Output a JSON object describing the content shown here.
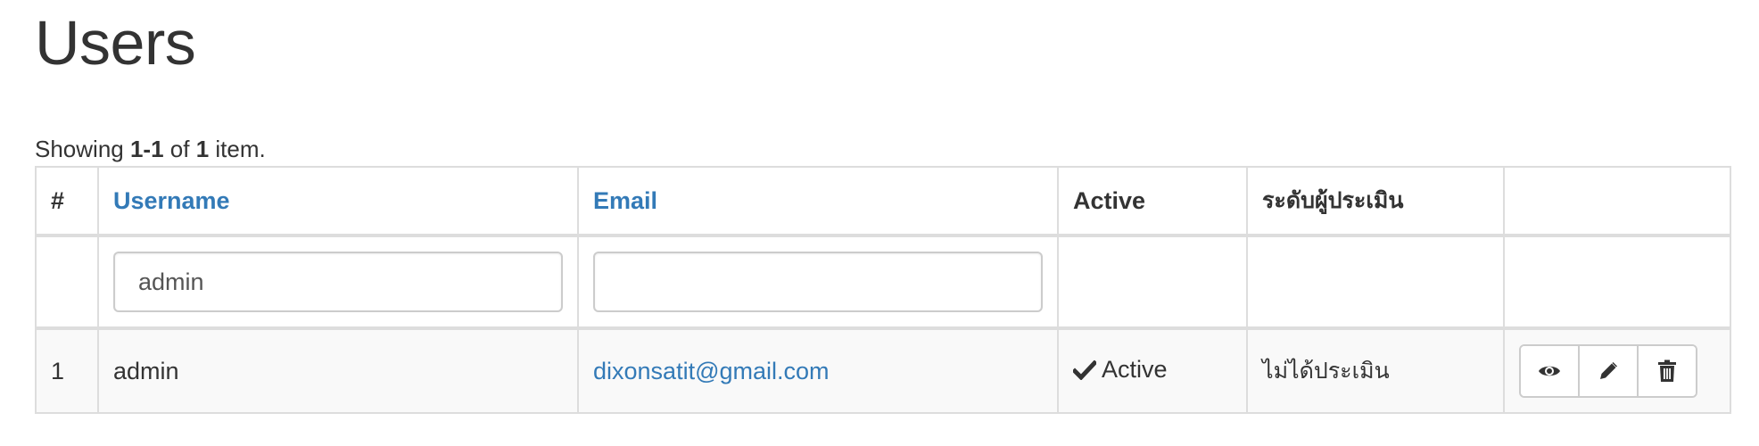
{
  "page": {
    "title": "Users"
  },
  "summary": {
    "prefix": "Showing ",
    "range": "1-1",
    "middle": " of ",
    "total": "1",
    "suffix": " item."
  },
  "table": {
    "headers": {
      "num": "#",
      "username": "Username",
      "email": "Email",
      "active": "Active",
      "level": "ระดับผู้ประเมิน"
    },
    "filters": {
      "username_value": "admin",
      "email_value": ""
    },
    "rows": [
      {
        "num": "1",
        "username": "admin",
        "email": "dixonsatit@gmail.com",
        "active": "Active",
        "level": "ไม่ได้ประเมิน"
      }
    ]
  },
  "icons": {
    "view": "eye-icon",
    "edit": "pencil-icon",
    "delete": "trash-icon",
    "active": "check-icon"
  },
  "colors": {
    "link": "#337ab7",
    "active": "#3c763d",
    "text": "#333333",
    "border": "#dddddd"
  }
}
